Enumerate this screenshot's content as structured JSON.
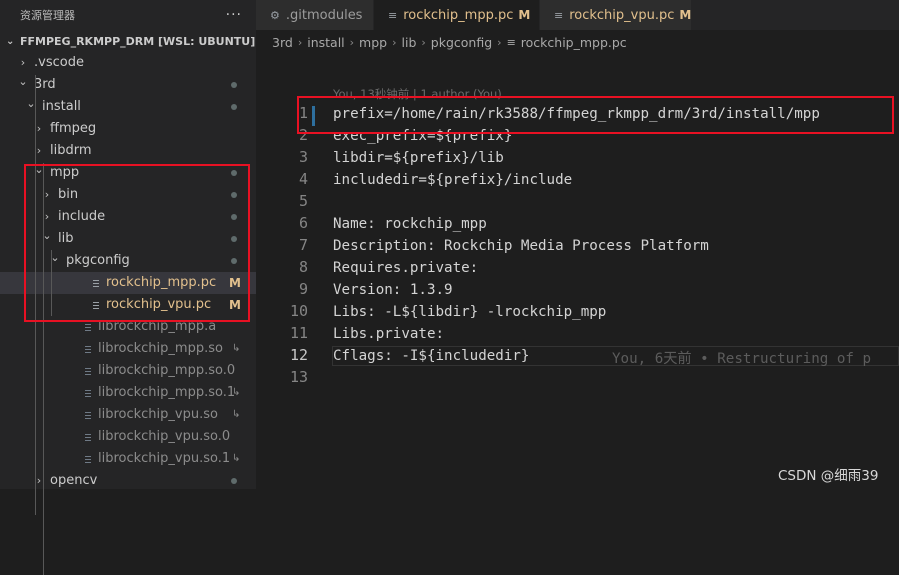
{
  "explorer": {
    "title": "资源管理器",
    "more": "···",
    "workspace": "FFMPEG_RKMPP_DRM [WSL: UBUNTU]",
    "items": [
      {
        "label": ".vscode",
        "depth": 1,
        "kind": "folder",
        "open": false
      },
      {
        "label": "3rd",
        "depth": 1,
        "kind": "folder",
        "open": true
      },
      {
        "label": "install",
        "depth": 2,
        "kind": "folder",
        "open": true
      },
      {
        "label": "ffmpeg",
        "depth": 3,
        "kind": "folder",
        "open": false
      },
      {
        "label": "libdrm",
        "depth": 3,
        "kind": "folder",
        "open": false
      },
      {
        "label": "mpp",
        "depth": 3,
        "kind": "folder",
        "open": true
      },
      {
        "label": "bin",
        "depth": 4,
        "kind": "folder",
        "open": false
      },
      {
        "label": "include",
        "depth": 4,
        "kind": "folder",
        "open": false
      },
      {
        "label": "lib",
        "depth": 4,
        "kind": "folder",
        "open": true
      },
      {
        "label": "pkgconfig",
        "depth": 5,
        "kind": "folder",
        "open": true
      },
      {
        "label": "rockchip_mpp.pc",
        "depth": 6,
        "kind": "file",
        "badge": "M"
      },
      {
        "label": "rockchip_vpu.pc",
        "depth": 6,
        "kind": "file",
        "badge": "M"
      },
      {
        "label": "librockchip_mpp.a",
        "depth": 5,
        "kind": "file"
      },
      {
        "label": "librockchip_mpp.so",
        "depth": 5,
        "kind": "file",
        "symlink": "↳"
      },
      {
        "label": "librockchip_mpp.so.0",
        "depth": 5,
        "kind": "file"
      },
      {
        "label": "librockchip_mpp.so.1",
        "depth": 5,
        "kind": "file",
        "symlink": "↳"
      },
      {
        "label": "librockchip_vpu.so",
        "depth": 5,
        "kind": "file",
        "symlink": "↳"
      },
      {
        "label": "librockchip_vpu.so.0",
        "depth": 5,
        "kind": "file"
      },
      {
        "label": "librockchip_vpu.so.1",
        "depth": 5,
        "kind": "file",
        "symlink": "↳"
      },
      {
        "label": "opencv",
        "depth": 3,
        "kind": "folder",
        "open": false
      }
    ]
  },
  "tabs": [
    {
      "label": ".gitmodules",
      "modified": ""
    },
    {
      "label": "rockchip_mpp.pc",
      "modified": "M",
      "close": "×"
    },
    {
      "label": "rockchip_vpu.pc",
      "modified": "M"
    }
  ],
  "breadcrumb": [
    "3rd",
    "install",
    "mpp",
    "lib",
    "pkgconfig",
    "rockchip_mpp.pc"
  ],
  "editor": {
    "codelens": "You, 13秒钟前 | 1 author (You)",
    "lines": [
      "prefix=/home/rain/rk3588/ffmpeg_rkmpp_drm/3rd/install/mpp",
      "exec_prefix=${prefix}",
      "libdir=${prefix}/lib",
      "includedir=${prefix}/include",
      "",
      "Name: rockchip_mpp",
      "Description: Rockchip Media Process Platform",
      "Requires.private:",
      "Version: 1.3.9",
      "Libs: -L${libdir} -lrockchip_mpp",
      "Libs.private:",
      "Cflags: -I${includedir}",
      ""
    ],
    "blame": "You, 6天前 • Restructuring of p"
  },
  "watermark": "CSDN @细雨39",
  "colors": {
    "modified": "#e2c08d",
    "highlight_box": "#e81123",
    "background": "#1e1e1e",
    "sidebar": "#252526"
  }
}
